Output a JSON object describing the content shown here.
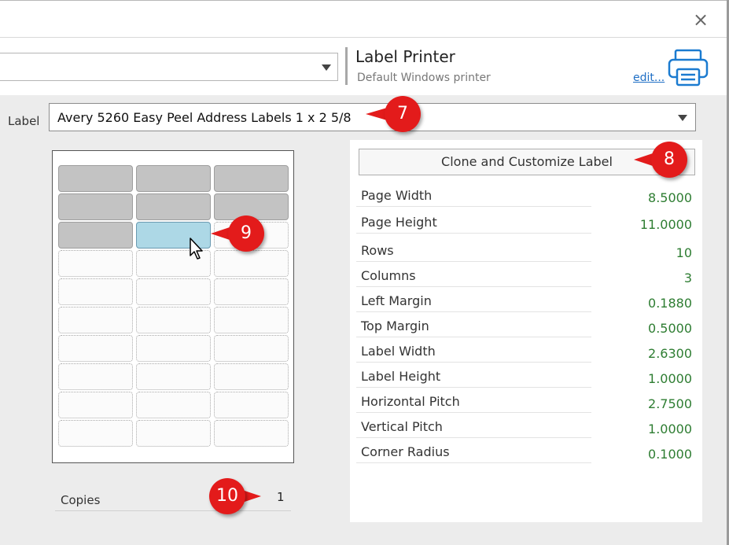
{
  "window": {
    "close_glyph": "×"
  },
  "printer": {
    "name": "Label Printer",
    "subtitle": "Default Windows printer",
    "edit_link": "edit...",
    "icon": "printer-icon"
  },
  "label": {
    "caption": "Label",
    "selected": "Avery 5260 Easy Peel Address Labels 1 x 2 5/8"
  },
  "sheet": {
    "rows": 10,
    "columns": 3,
    "used_cells": 7,
    "start_cell": {
      "row": 3,
      "column": 2
    }
  },
  "copies": {
    "label": "Copies",
    "value": "1"
  },
  "clone_button": "Clone and Customize Label",
  "properties": [
    {
      "name": "Page Width",
      "value": "8.5000"
    },
    {
      "name": "Page Height",
      "value": "11.0000"
    },
    {
      "name": "Rows",
      "value": "10"
    },
    {
      "name": "Columns",
      "value": "3"
    },
    {
      "name": "Left Margin",
      "value": "0.1880"
    },
    {
      "name": "Top Margin",
      "value": "0.5000"
    },
    {
      "name": "Label Width",
      "value": "2.6300"
    },
    {
      "name": "Label Height",
      "value": "1.0000"
    },
    {
      "name": "Horizontal Pitch",
      "value": "2.7500"
    },
    {
      "name": "Vertical Pitch",
      "value": "1.0000"
    },
    {
      "name": "Corner Radius",
      "value": "0.1000"
    }
  ],
  "callouts": [
    "7",
    "8",
    "9",
    "10"
  ],
  "colors": {
    "callout": "#e31b1b",
    "value_green": "#2e7d32",
    "start_cell": "#add8e6",
    "used_cell": "#c3c3c3",
    "link": "#1f6fc5"
  }
}
